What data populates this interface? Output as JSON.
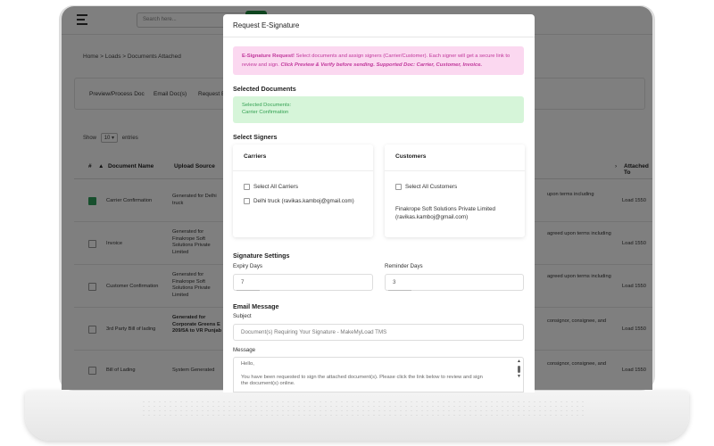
{
  "app": {
    "search_placeholder": "Search here...",
    "breadcrumb": "Home > Loads > Documents Attached",
    "tabs": [
      "Preview/Process Doc",
      "Email Doc(s)",
      "Request E"
    ],
    "show": {
      "prefix": "Show",
      "value": "10",
      "suffix": "entries"
    },
    "table": {
      "headers": [
        "#",
        "Document Name",
        "Upload Source",
        "Attached To"
      ],
      "rows": [
        {
          "checked": true,
          "name": "Carrier Confirmation",
          "source": "Generated for Delhi truck",
          "terms": "upon terms including",
          "attached": "Load 1550"
        },
        {
          "checked": false,
          "name": "Invoice",
          "source": "Generated for Finakrope Soft Solutions Private Limited",
          "terms": "agreed upon terms including",
          "attached": "Load 1550"
        },
        {
          "checked": false,
          "name": "Customer Confirmation",
          "source": "Generated for Finakrope Soft Solutions Private Limited",
          "terms": "agreed upon terms including",
          "attached": "Load 1550"
        },
        {
          "checked": false,
          "name": "3rd Party Bill of lading",
          "source": "Generated for Corporate Greens E 209/5A to VR Punjab",
          "terms": "consignor, consignee, and",
          "attached": "Load 1550"
        },
        {
          "checked": false,
          "name": "Bill of Lading",
          "source": "System Generated",
          "terms": "consignor, consignee, and",
          "attached": "Load 1550"
        }
      ]
    }
  },
  "modal": {
    "title": "Request E-Signature",
    "info": {
      "lead": "E-Signature Request!",
      "text": " Select documents and assign signers (Carrier/Customer). Each signer will get a secure link to review and sign. ",
      "note": "Click Preview & Verify before sending. Supported Doc: Carrier, Customer, Invoice."
    },
    "selected_docs": {
      "title": "Selected Documents",
      "line1": "Selected Documents:",
      "line2": "Carrier Confirmation"
    },
    "signers": {
      "title": "Select Signers",
      "carriers": {
        "title": "Carriers",
        "select_all": "Select All Carriers",
        "items": [
          "Delhi truck (ravikas.kamboj@gmail.com)"
        ]
      },
      "customers": {
        "title": "Customers",
        "select_all": "Select All Customers",
        "items": [
          "Finakrope Soft Solutions Private Limited",
          "(ravikas.kamboj@gmail.com)"
        ]
      }
    },
    "settings": {
      "title": "Signature Settings",
      "expiry_label": "Expiry Days",
      "expiry_value": "7",
      "reminder_label": "Reminder Days",
      "reminder_value": "3"
    },
    "email": {
      "title": "Email Message",
      "subject_label": "Subject",
      "subject_value": "Document(s) Requiring Your Signature - MakeMyLoad TMS",
      "message_label": "Message",
      "message_lines": [
        "Hello,",
        "You have been requested to sign the attached document(s). Please click the link below to review and sign",
        "the document(s) online."
      ]
    }
  }
}
